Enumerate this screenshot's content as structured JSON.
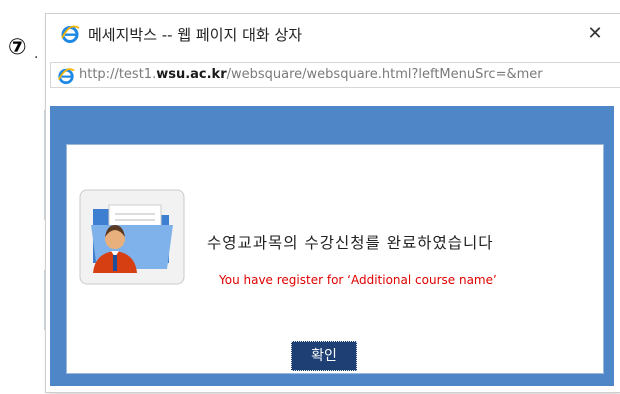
{
  "step": {
    "badge": "⑦",
    "dot": "."
  },
  "window": {
    "title": "메세지박스 -- 웹 페이지 대화 상자",
    "close_label": "✕"
  },
  "address": {
    "protocol": "http://",
    "host_prefix": "test1.",
    "host_domain": "wsu.ac.kr",
    "path": "/websquare/websquare.html?leftMenuSrc=&mer"
  },
  "dialog": {
    "message_korean": "수영교과목의 수강신청를 완료하였습니다",
    "message_english": "You have register for ‘Additional course name’",
    "ok_label": "확인"
  },
  "colors": {
    "content_blue": "#4f86c7",
    "button_navy": "#1d3f74",
    "english_message_red": "#e00000"
  },
  "icons": {
    "title": "internet-explorer-icon",
    "address": "internet-explorer-icon",
    "message": "user-folder-icon"
  }
}
